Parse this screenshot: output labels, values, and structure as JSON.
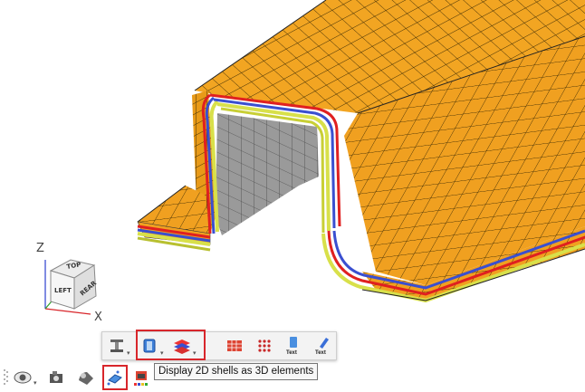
{
  "viewcube": {
    "top": "TOP",
    "left": "LEFT",
    "rear": "REAR"
  },
  "axes": {
    "z": "Z",
    "x": "X"
  },
  "popup_toolbar": {
    "text_icon_1": "Text",
    "text_icon_2": "Text"
  },
  "tooltip": {
    "text": "Display 2D shells as 3D elements"
  },
  "colors": {
    "shell_orange": "#f0a020",
    "layer_red": "#e02020",
    "layer_blue": "#3a4fd0",
    "layer_yellow": "#d8e04a",
    "highlight": "#d8262b"
  }
}
